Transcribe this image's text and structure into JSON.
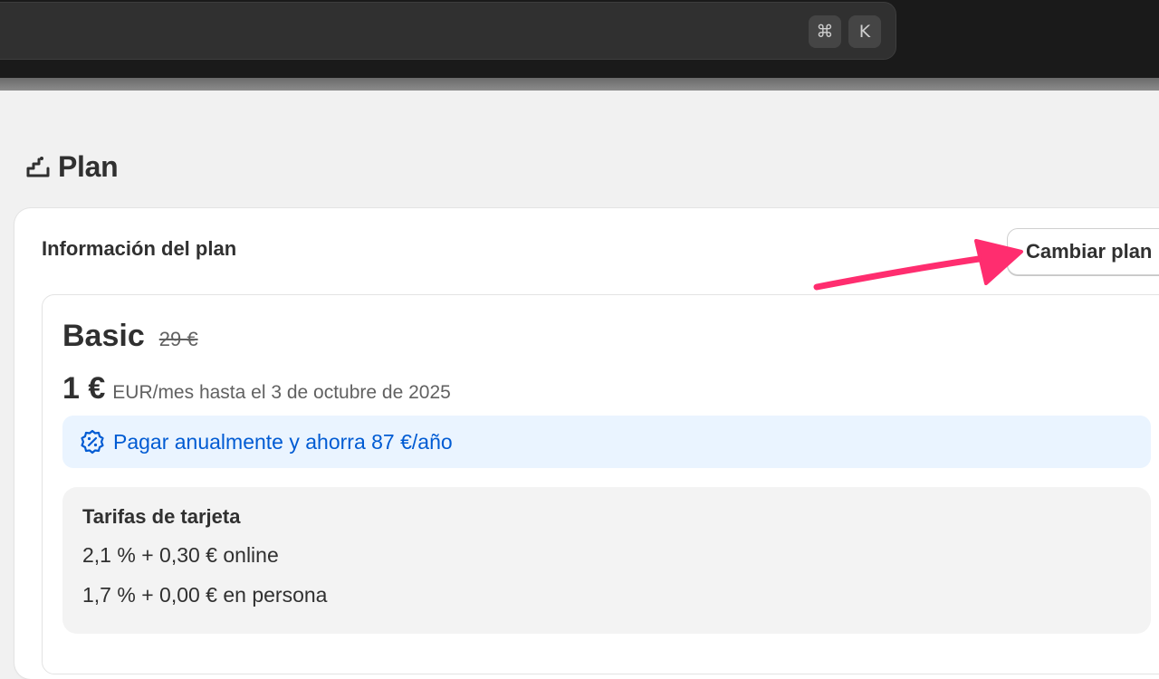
{
  "topbar": {
    "shortcut_keys": [
      "⌘",
      "K"
    ]
  },
  "page": {
    "title": "Plan",
    "icon": "plan-stairs-icon"
  },
  "card": {
    "title": "Información del plan",
    "change_plan_label": "Cambiar plan"
  },
  "plan": {
    "name": "Basic",
    "original_price": "29 €",
    "price": "1 €",
    "price_period": "EUR/mes hasta el 3 de octubre de 2025",
    "promo": {
      "icon": "discount-badge-icon",
      "text": "Pagar anualmente y ahorra 87 €/año"
    }
  },
  "fees": {
    "title": "Tarifas de tarjeta",
    "lines": [
      "2,1 % + 0,30 € online",
      "1,7 % + 0,00 € en persona"
    ]
  },
  "colors": {
    "annotation_arrow": "#ff2d6f",
    "link_blue": "#005bd3",
    "promo_background": "#eaf4ff"
  }
}
